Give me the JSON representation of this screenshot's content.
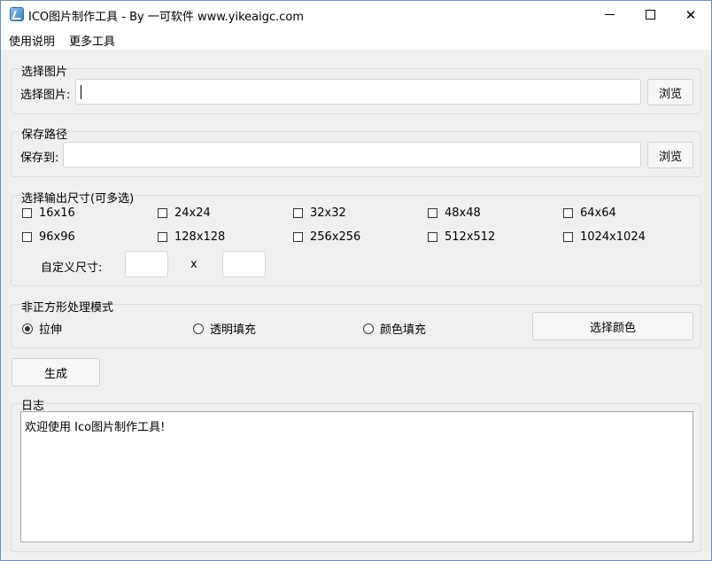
{
  "window": {
    "title": "ICO图片制作工具 - By 一可软件 www.yikeaigc.com",
    "minimize": "minimize",
    "maximize": "maximize",
    "close": "✕"
  },
  "menu": {
    "items": [
      "使用说明",
      "更多工具"
    ]
  },
  "select_image": {
    "group_title": "选择图片",
    "label": "选择图片:",
    "value": "",
    "browse": "浏览"
  },
  "save_path": {
    "group_title": "保存路径",
    "label": "保存到:",
    "value": "",
    "browse": "浏览"
  },
  "sizes": {
    "group_title": "选择输出尺寸(可多选)",
    "options": [
      {
        "label": "16x16",
        "checked": false
      },
      {
        "label": "24x24",
        "checked": false
      },
      {
        "label": "32x32",
        "checked": false
      },
      {
        "label": "48x48",
        "checked": false
      },
      {
        "label": "64x64",
        "checked": false
      },
      {
        "label": "96x96",
        "checked": false
      },
      {
        "label": "128x128",
        "checked": false
      },
      {
        "label": "256x256",
        "checked": false
      },
      {
        "label": "512x512",
        "checked": false
      },
      {
        "label": "1024x1024",
        "checked": false
      }
    ],
    "custom_label": "自定义尺寸:",
    "custom_width": "",
    "custom_sep": "x",
    "custom_height": ""
  },
  "mode": {
    "group_title": "非正方形处理模式",
    "options": [
      {
        "label": "拉伸",
        "checked": true
      },
      {
        "label": "透明填充",
        "checked": false
      },
      {
        "label": "颜色填充",
        "checked": false
      }
    ],
    "choose_color": "选择颜色"
  },
  "generate": "生成",
  "log": {
    "group_title": "日志",
    "text": "欢迎使用 Ico图片制作工具!"
  }
}
